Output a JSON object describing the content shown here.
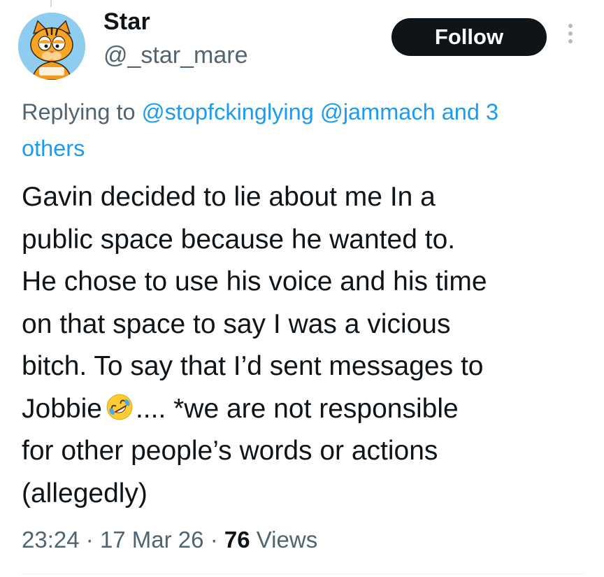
{
  "author": {
    "display_name": "Star",
    "handle": "@_star_mare",
    "avatar_icon": "cartoon-cat-avatar-icon"
  },
  "follow_button": {
    "label": "Follow"
  },
  "more_menu": {
    "icon": "vertical-ellipsis-icon"
  },
  "reply": {
    "prefix": "Replying to",
    "mentions": [
      "@stopfckinglying",
      "@jammach"
    ],
    "and_text": "and 3",
    "others_text": "others"
  },
  "tweet": {
    "lines": [
      "Gavin decided to lie about me In a",
      "public space because he wanted to.",
      "He chose to use his voice and his time",
      "on that space to say I was a vicious",
      "bitch. To say that I’d sent messages to"
    ],
    "line6_before_emoji": "Jobbie",
    "line6_emoji": "rolling-on-floor-laughing-emoji",
    "line6_after_emoji": ".... *we are not responsible",
    "lines_after": [
      "for other people’s words or actions",
      "(allegedly)"
    ]
  },
  "meta": {
    "time": "23:24",
    "separator": "·",
    "date": "17 Mar 26",
    "views_count": "76",
    "views_label": "Views"
  },
  "colors": {
    "link_blue": "#1d9bf0",
    "secondary_text": "#536471",
    "primary_text": "#0f1419",
    "button_bg": "#0f1419",
    "button_text": "#ffffff"
  }
}
